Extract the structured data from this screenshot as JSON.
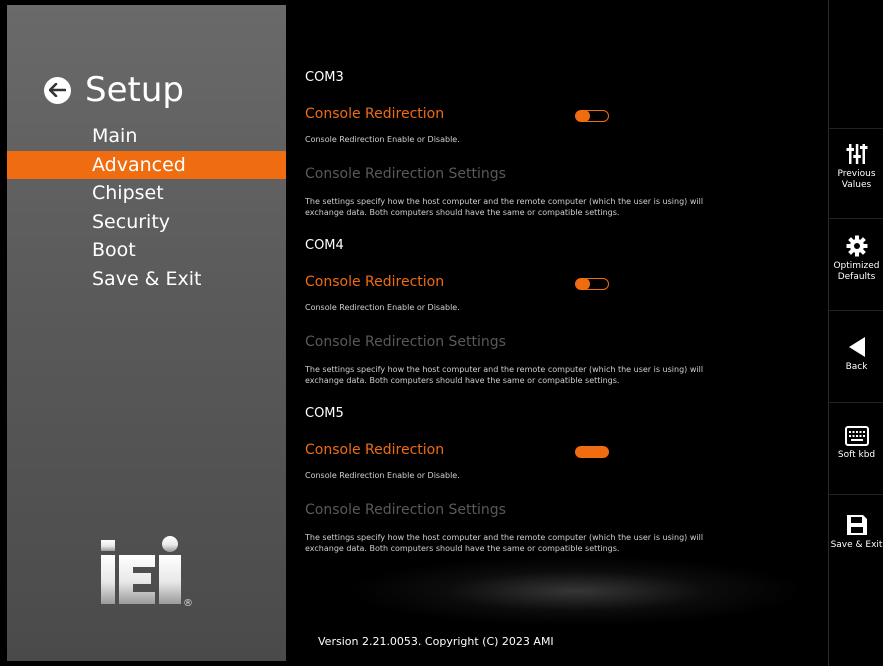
{
  "sidebar": {
    "title": "Setup",
    "menu": [
      "Main",
      "Advanced",
      "Chipset",
      "Security",
      "Boot",
      "Save & Exit"
    ],
    "active_index": 1,
    "logo_text": "iEi",
    "logo_mark": "®"
  },
  "sections": [
    {
      "title": "COM3",
      "option_label": "Console Redirection",
      "option_desc": "Console Redirection Enable or Disable.",
      "toggle_state": "off",
      "sub_label": "Console Redirection Settings",
      "sub_desc_line1": "The settings specify how the host computer and the remote computer (which the user is using) will",
      "sub_desc_line2": "exchange data. Both computers should have the same or compatible settings."
    },
    {
      "title": "COM4",
      "option_label": "Console Redirection",
      "option_desc": "Console Redirection Enable or Disable.",
      "toggle_state": "off",
      "sub_label": "Console Redirection Settings",
      "sub_desc_line1": "The settings specify how the host computer and the remote computer (which the user is using) will",
      "sub_desc_line2": "exchange data. Both computers should have the same or compatible settings."
    },
    {
      "title": "COM5",
      "option_label": "Console Redirection",
      "option_desc": "Console Redirection Enable or Disable.",
      "toggle_state": "on",
      "sub_label": "Console Redirection Settings",
      "sub_desc_line1": "The settings specify how the host computer and the remote computer (which the user is using) will",
      "sub_desc_line2": "exchange data. Both computers should have the same or compatible settings."
    }
  ],
  "footer": {
    "version": "Version 2.21.0053. Copyright (C) 2023 AMI"
  },
  "right_bar": {
    "previous_values": {
      "line1": "Previous",
      "line2": "Values",
      "icon": "sliders-icon"
    },
    "optimized_defaults": {
      "line1": "Optimized",
      "line2": "Defaults",
      "icon": "gear-icon"
    },
    "back": {
      "line1": "Back",
      "icon": "back-arrow-icon"
    },
    "soft_kbd": {
      "line1": "Soft kbd",
      "icon": "keyboard-icon"
    },
    "save_exit": {
      "line1": "Save & Exit",
      "icon": "floppy-disk-icon"
    }
  },
  "colors": {
    "accent": "#f06c10",
    "sidebar_bg": "#5e5e5e",
    "muted": "#595959"
  }
}
